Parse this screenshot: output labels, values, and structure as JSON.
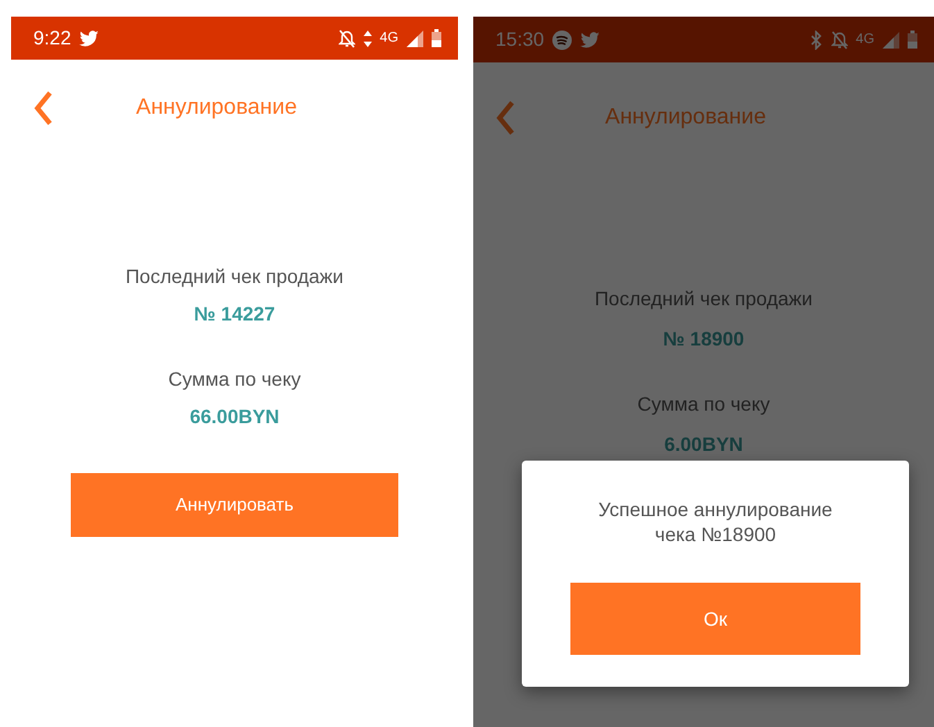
{
  "screens": [
    {
      "dimmed": false,
      "status_bar": {
        "time": "9:22",
        "left_icons": [
          {
            "kind": "bird"
          }
        ],
        "right_icons": [
          {
            "kind": "bell-off"
          },
          {
            "kind": "data-arrows"
          },
          {
            "kind": "network",
            "text": "4G"
          },
          {
            "kind": "signal"
          },
          {
            "kind": "battery"
          }
        ]
      },
      "header": {
        "title": "Аннулирование"
      },
      "receipt": {
        "label": "Последний чек продажи",
        "number": "№ 14227",
        "sum_label": "Сумма по чеку",
        "sum": "66.00BYN"
      },
      "action_button": "Аннулировать"
    },
    {
      "dimmed": true,
      "status_bar": {
        "time": "15:30",
        "left_icons": [
          {
            "kind": "music-circle"
          },
          {
            "kind": "bird"
          }
        ],
        "right_icons": [
          {
            "kind": "bluetooth"
          },
          {
            "kind": "bell-off"
          },
          {
            "kind": "network",
            "text": "4G"
          },
          {
            "kind": "signal"
          },
          {
            "kind": "battery"
          }
        ]
      },
      "header": {
        "title": "Аннулирование"
      },
      "receipt": {
        "label": "Последний чек продажи",
        "number": "№ 18900",
        "sum_label": "Сумма по чеку",
        "sum": "6.00BYN"
      },
      "dialog": {
        "message": "Успешное аннулирование чека №18900",
        "button": "Ок"
      }
    }
  ]
}
